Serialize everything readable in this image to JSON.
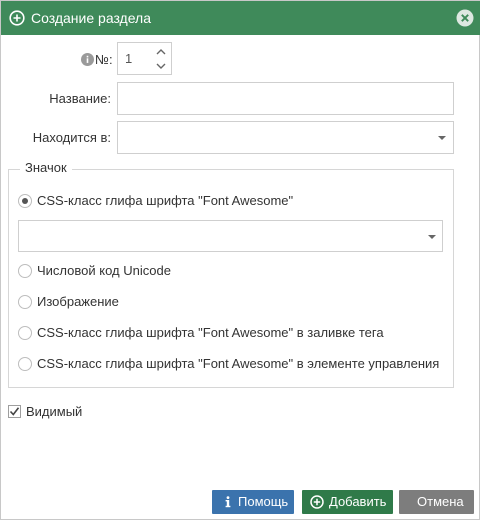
{
  "dialog": {
    "title": "Создание раздела",
    "colors": {
      "titlebar": "#3f8a5a",
      "help_button": "#3b73ad",
      "add_button": "#2f7a49",
      "cancel_button": "#7d7d7d"
    }
  },
  "form": {
    "number_label": "№:",
    "number_value": "1",
    "name_label": "Название:",
    "name_value": "",
    "parent_label": "Находится в:",
    "parent_value": ""
  },
  "icon_group": {
    "legend": "Значок",
    "options": [
      {
        "label": "CSS-класс глифа шрифта \"Font Awesome\"",
        "selected": true
      },
      {
        "label": "Числовой код Unicode",
        "selected": false
      },
      {
        "label": "Изображение",
        "selected": false
      },
      {
        "label": "CSS-класс глифа шрифта \"Font Awesome\" в заливке тега",
        "selected": false
      },
      {
        "label": "CSS-класс глифа шрифта \"Font Awesome\" в элементе управления",
        "selected": false
      }
    ],
    "glyph_class_value": ""
  },
  "visible": {
    "label": "Видимый",
    "checked": true
  },
  "buttons": {
    "help": "Помощь",
    "add": "Добавить",
    "cancel": "Отмена"
  },
  "icons": [
    "plus-circle-icon",
    "close-circle-icon",
    "info-icon",
    "chevron-down-icon",
    "checkmark-icon"
  ]
}
